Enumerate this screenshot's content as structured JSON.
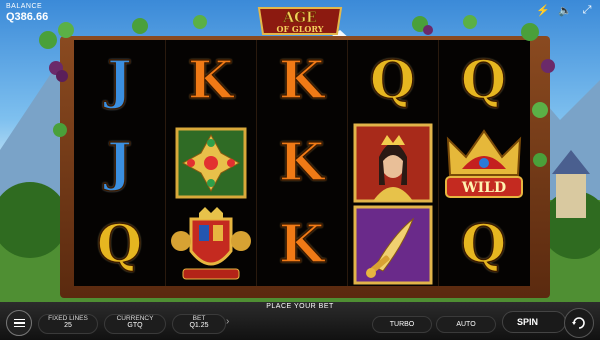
{
  "balance": {
    "label": "BALANCE",
    "value": "Q386.66"
  },
  "logo": {
    "line1": "AGE",
    "line2": "OF GLORY"
  },
  "top_icons": [
    "lightning-icon",
    "speaker-icon",
    "fullscreen-icon"
  ],
  "reels": [
    [
      "J",
      "J",
      "Q"
    ],
    [
      "K",
      "ruby-cross",
      "royal-crest"
    ],
    [
      "K",
      "K",
      "K"
    ],
    [
      "Q",
      "queen",
      "dagger"
    ],
    [
      "Q",
      "WILD",
      "Q"
    ]
  ],
  "wild_label": "WILD",
  "bottom": {
    "place_your_bet": "PLACE YOUR BET",
    "fixed_lines_label": "FIXED LINES",
    "fixed_lines_value": "25",
    "currency_label": "CURRENCY",
    "currency_value": "GTQ",
    "bet_label": "BET",
    "bet_value": "Q1.25",
    "turbo_label": "TURBO",
    "auto_label": "AUTO",
    "spin_label": "SPIN"
  },
  "colors": {
    "letter_J": "#3b8fe0",
    "letter_K": "#f07a16",
    "letter_Q": "#e6b620",
    "frame": "#6b3414"
  }
}
